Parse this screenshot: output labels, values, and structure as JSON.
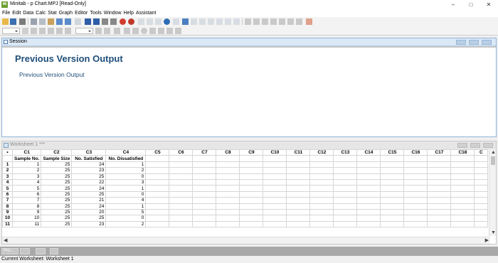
{
  "window": {
    "title": "Minitab - p Chart.MPJ  [Read-Only]",
    "icon_text": "Mi",
    "controls": [
      "–",
      "□",
      "✕"
    ]
  },
  "menu": [
    "File",
    "Edit",
    "Data",
    "Calc",
    "Stat",
    "Graph",
    "Editor",
    "Tools",
    "Window",
    "Help",
    "Assistant"
  ],
  "session": {
    "title": "Session",
    "heading": "Previous Version Output",
    "subheading": "Previous Version Output"
  },
  "worksheet": {
    "title": "Worksheet 1 ***",
    "corner_mark": "•",
    "column_ids": [
      "C1",
      "C2",
      "C3",
      "C4",
      "C5",
      "C6",
      "C7",
      "C8",
      "C9",
      "C10",
      "C11",
      "C12",
      "C13",
      "C14",
      "C15",
      "C16",
      "C17",
      "C18",
      "C"
    ],
    "column_names": [
      "Sample No.",
      "Sample Size",
      "No. Satisfied",
      "No. Dissatisfied",
      "",
      "",
      "",
      "",
      "",
      "",
      "",
      "",
      "",
      "",
      "",
      "",
      "",
      "",
      ""
    ],
    "rows": [
      {
        "n": "1",
        "cells": [
          "1",
          "25",
          "24",
          "1"
        ]
      },
      {
        "n": "2",
        "cells": [
          "2",
          "25",
          "23",
          "2"
        ]
      },
      {
        "n": "3",
        "cells": [
          "3",
          "25",
          "25",
          "0"
        ]
      },
      {
        "n": "4",
        "cells": [
          "4",
          "25",
          "22",
          "3"
        ]
      },
      {
        "n": "5",
        "cells": [
          "5",
          "25",
          "24",
          "1"
        ]
      },
      {
        "n": "6",
        "cells": [
          "6",
          "25",
          "25",
          "0"
        ]
      },
      {
        "n": "7",
        "cells": [
          "7",
          "25",
          "21",
          "4"
        ]
      },
      {
        "n": "8",
        "cells": [
          "8",
          "25",
          "24",
          "1"
        ]
      },
      {
        "n": "9",
        "cells": [
          "9",
          "25",
          "20",
          "5"
        ]
      },
      {
        "n": "10",
        "cells": [
          "10",
          "25",
          "25",
          "0"
        ]
      },
      {
        "n": "11",
        "cells": [
          "11",
          "25",
          "23",
          "2"
        ]
      }
    ]
  },
  "tabs": {
    "minimized_session": "Pro..."
  },
  "status": {
    "text": "Current Worksheet: Worksheet 1"
  },
  "icons": {
    "toolbar1": [
      "open-icon",
      "save-icon",
      "print-icon",
      "cut-icon",
      "copy-icon",
      "paste-icon",
      "undo-icon",
      "redo-icon",
      "edit-last-dialog-icon",
      "insert-cells-icon",
      "move-up-icon",
      "move-down-icon",
      "find-icon",
      "find-next-icon",
      "cancel-icon",
      "help-icon",
      "session-window-icon",
      "project-manager-icon",
      "worksheet-icon",
      "info-icon",
      "graph-folder-icon",
      "report-pad-icon",
      "related-docs-icon",
      "design-icon",
      "layout-icon",
      "graph-icon",
      "brush-icon",
      "grid-icon",
      "regression-icon",
      "scatterplot-icon",
      "delete-icon"
    ],
    "toolbar2": [
      "font-dropdown",
      "select-icon",
      "point-icon",
      "crosshair-icon",
      "flag-icon",
      "stack-icon",
      "size-dropdown",
      "delete-x-icon",
      "zoom-icon",
      "pointer-icon",
      "text-icon",
      "rectangle-icon",
      "ellipse-icon",
      "line-icon",
      "dot-icon",
      "add-graph-icon",
      "polygon-icon"
    ]
  },
  "colors": {
    "heading": "#1f4e79",
    "pane_title": "#dbe8f5",
    "tab_strip": "#a8a8a8"
  }
}
